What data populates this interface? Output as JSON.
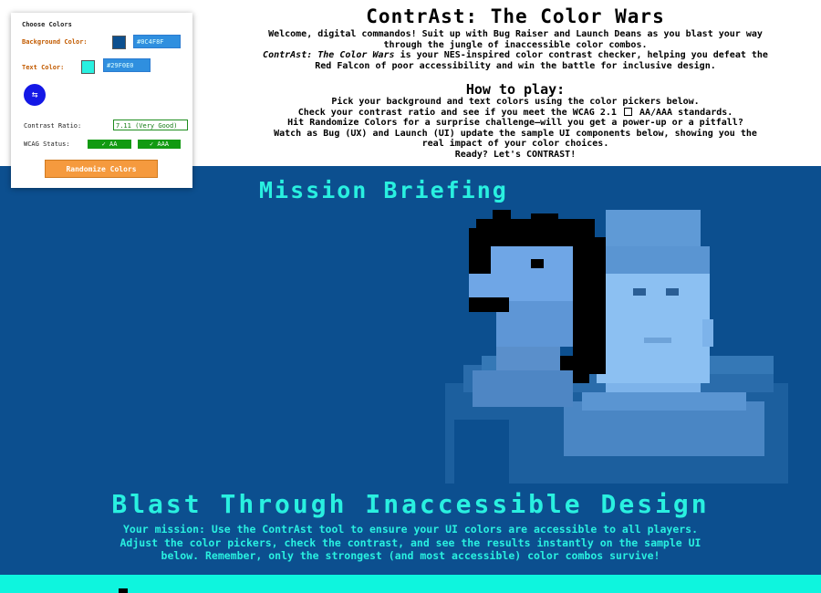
{
  "panel": {
    "heading": "Choose Colors",
    "bg_label": "Background Color:",
    "bg_value": "#0C4F8F",
    "text_label": "Text Color:",
    "text_value": "#29F0E0",
    "swap_icon": "swap-arrows-icon",
    "ratio_label": "Contrast Ratio:",
    "ratio_value": "7.11 (Very Good)",
    "wcag_label": "WCAG Status:",
    "aa": "✓ AA",
    "aaa": "✓ AAA",
    "randomize": "Randomize Colors"
  },
  "header": {
    "title": "ContrAst: The Color Wars",
    "intro_1": "Welcome, digital commandos! Suit up with Bug Raiser and Launch Deans as you blast your way",
    "intro_2": "through the jungle of inaccessible color combos.",
    "intro_3a": "ContrAst: The Color Wars",
    "intro_3b": " is your NES-inspired color contrast checker, helping you defeat the",
    "intro_4": "Red Falcon of poor accessibility and win the battle for inclusive design.",
    "howto_title": "How to play:",
    "step_1": "Pick your background and text colors using the color pickers below.",
    "step_2a": "Check your contrast ratio and see if you meet the WCAG 2.1",
    "step_2b": "AA/AAA standards.",
    "step_3": "Hit Randomize Colors for a surprise challenge—will you get a power-up or a pitfall?",
    "step_4": "Watch as Bug (UX) and Launch (UI) update the sample UI components below, showing you the",
    "step_5": "real impact of your color choices.",
    "step_6": "Ready? Let's CONTRAST!"
  },
  "hero": {
    "mission_title": "Mission Briefing",
    "blast_title": "Blast Through Inaccessible Design",
    "mission_1": "Your mission: Use the ContrAst tool to ensure your UI colors are accessible to all players.",
    "mission_2": "Adjust the color pickers, check the contrast, and see the results instantly on the sample UI",
    "mission_3": "below. Remember, only the strongest (and most accessible) color combos survive!"
  },
  "colors": {
    "background": "#0C4F8F",
    "text": "#29F0E0",
    "accent_orange": "#F59A3E",
    "pass_green": "#129A12",
    "swap_blue": "#1418E6"
  }
}
